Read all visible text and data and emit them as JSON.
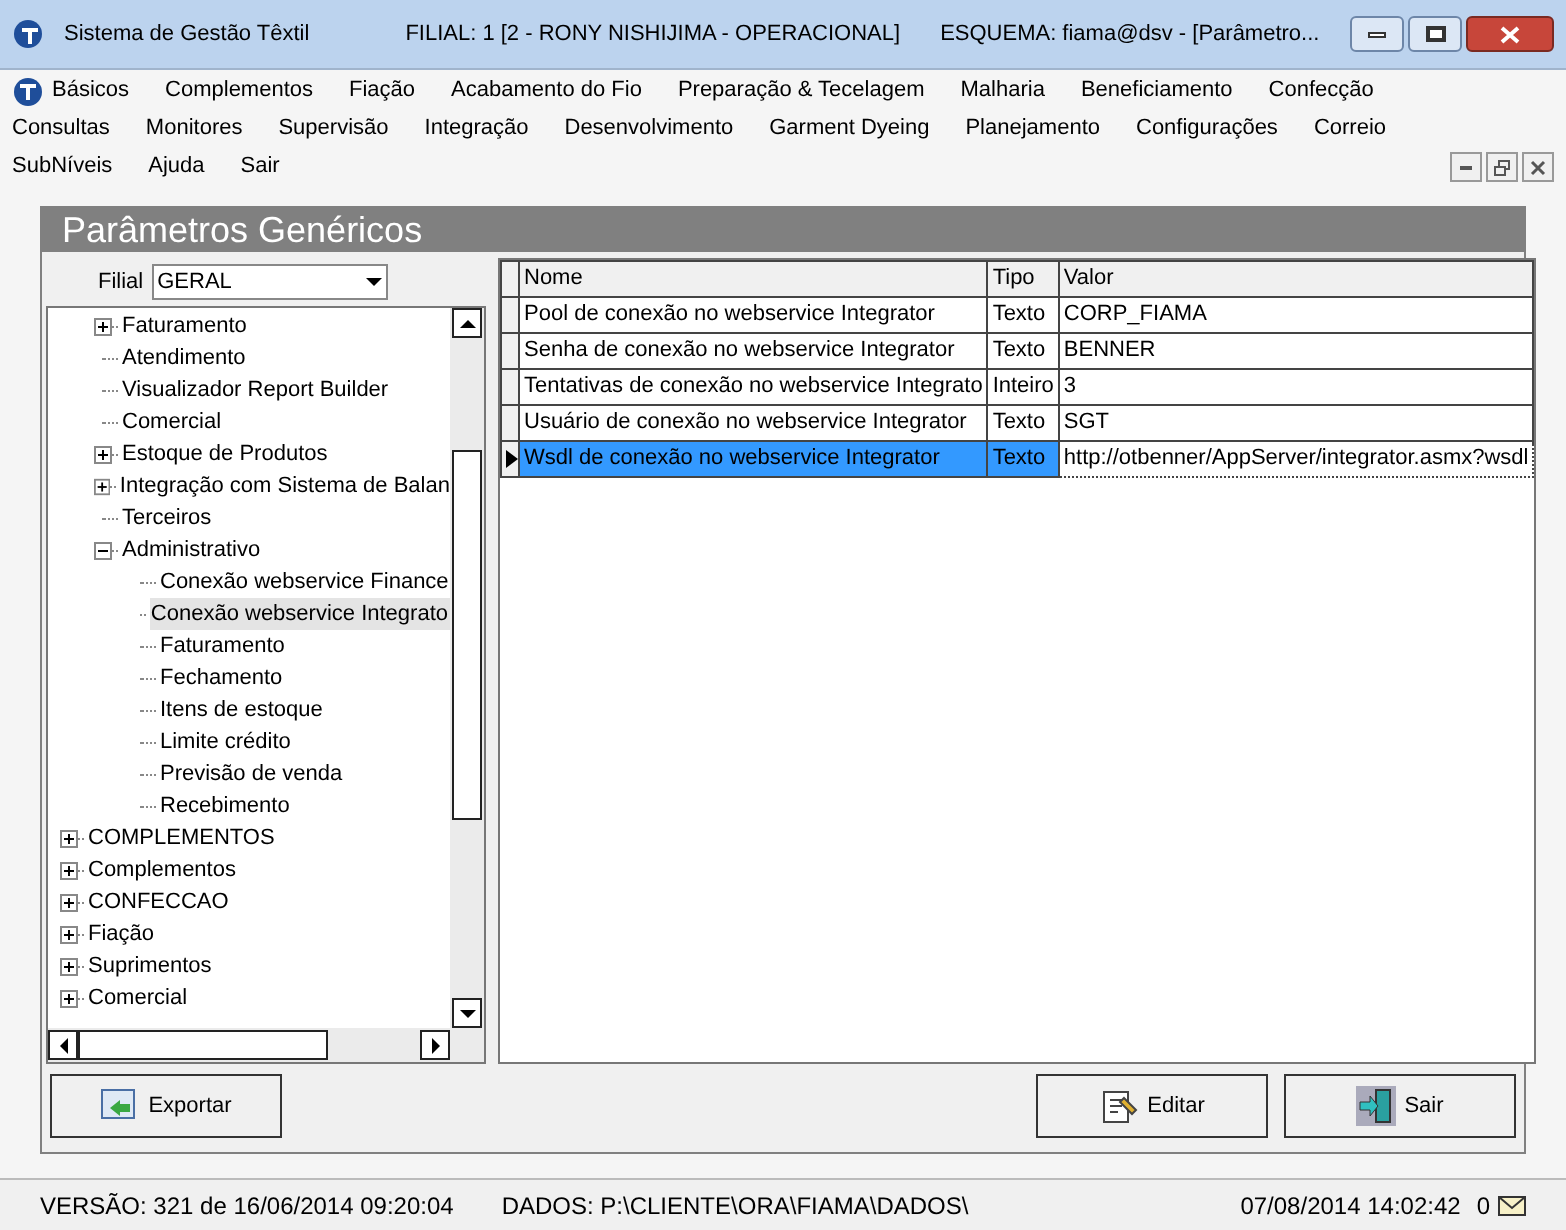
{
  "window": {
    "title": "Sistema de Gestão Têxtil",
    "filial": "FILIAL: 1 [2 - RONY NISHIJIMA - OPERACIONAL]",
    "esquema": "ESQUEMA: fiama@dsv - [Parâmetro..."
  },
  "menu": [
    [
      "Básicos",
      "Complementos",
      "Fiação",
      "Acabamento do Fio",
      "Preparação & Tecelagem",
      "Malharia",
      "Beneficiamento",
      "Confecção"
    ],
    [
      "Consultas",
      "Monitores",
      "Supervisão",
      "Integração",
      "Desenvolvimento",
      "Garment Dyeing",
      "Planejamento",
      "Configurações",
      "Correio"
    ],
    [
      "SubNíveis",
      "Ajuda",
      "Sair"
    ]
  ],
  "child": {
    "title": "Parâmetros Genéricos",
    "filial_label": "Filial",
    "filial_value": "GERAL"
  },
  "tree": {
    "continued": [
      {
        "label": "Faturamento",
        "kind": "folder",
        "expanded": false,
        "selected": false
      },
      {
        "label": "Atendimento",
        "kind": "leaf",
        "selected": false
      },
      {
        "label": "Visualizador Report Builder",
        "kind": "leaf",
        "selected": false
      },
      {
        "label": "Comercial",
        "kind": "leaf",
        "selected": false
      },
      {
        "label": "Estoque de Produtos",
        "kind": "folder",
        "expanded": false,
        "selected": false
      },
      {
        "label": "Integração com Sistema de Balan",
        "kind": "folder",
        "expanded": false,
        "selected": false
      },
      {
        "label": "Terceiros",
        "kind": "leaf",
        "selected": false
      },
      {
        "label": "Administrativo",
        "kind": "folder",
        "expanded": true,
        "selected": false,
        "children": [
          {
            "label": "Conexão webservice Finance",
            "kind": "leaf",
            "selected": false
          },
          {
            "label": "Conexão webservice Integrato",
            "kind": "leaf",
            "selected": true
          },
          {
            "label": "Faturamento",
            "kind": "leaf",
            "selected": false
          },
          {
            "label": "Fechamento",
            "kind": "leaf",
            "selected": false
          },
          {
            "label": "Itens de estoque",
            "kind": "leaf",
            "selected": false
          },
          {
            "label": "Limite crédito",
            "kind": "leaf",
            "selected": false
          },
          {
            "label": "Previsão de venda",
            "kind": "leaf",
            "selected": false
          },
          {
            "label": "Recebimento",
            "kind": "leaf",
            "selected": false
          }
        ]
      }
    ],
    "items": [
      {
        "label": "COMPLEMENTOS",
        "kind": "folder",
        "expanded": false,
        "selected": false
      },
      {
        "label": "Complementos",
        "kind": "folder",
        "expanded": false,
        "selected": false
      },
      {
        "label": "CONFECCAO",
        "kind": "folder",
        "expanded": false,
        "selected": false
      },
      {
        "label": "Fiação",
        "kind": "folder",
        "expanded": false,
        "selected": false
      },
      {
        "label": "Suprimentos",
        "kind": "folder",
        "expanded": false,
        "selected": false
      },
      {
        "label": "Comercial",
        "kind": "folder",
        "expanded": false,
        "selected": false
      }
    ]
  },
  "table": {
    "columns": [
      "Nome",
      "Tipo",
      "Valor"
    ],
    "rows": [
      {
        "cells": [
          "Pool de conexão no webservice Integrator",
          "Texto",
          "CORP_FIAMA"
        ],
        "selected": false
      },
      {
        "cells": [
          "Senha de conexão no webservice Integrator",
          "Texto",
          "BENNER"
        ],
        "selected": false
      },
      {
        "cells": [
          "Tentativas de conexão no webservice Integrato",
          "Inteiro",
          "3"
        ],
        "selected": false
      },
      {
        "cells": [
          "Usuário de conexão no webservice Integrator",
          "Texto",
          "SGT"
        ],
        "selected": false
      },
      {
        "cells": [
          "Wsdl de conexão no webservice Integrator",
          "Texto",
          "http://otbenner/AppServer/integrator.asmx?wsdl"
        ],
        "selected": true
      }
    ]
  },
  "buttons": {
    "left": [
      "Exportar"
    ],
    "right": [
      "Editar",
      "Sair"
    ]
  },
  "status_bar": {
    "version": "VERSÃO: 321 de 16/06/2014 09:20:04",
    "dados": "DADOS: P:\\CLIENTE\\ORA\\FIAMA\\DADOS\\",
    "datetime": "07/08/2014 14:02:42",
    "mail_count": "0"
  }
}
